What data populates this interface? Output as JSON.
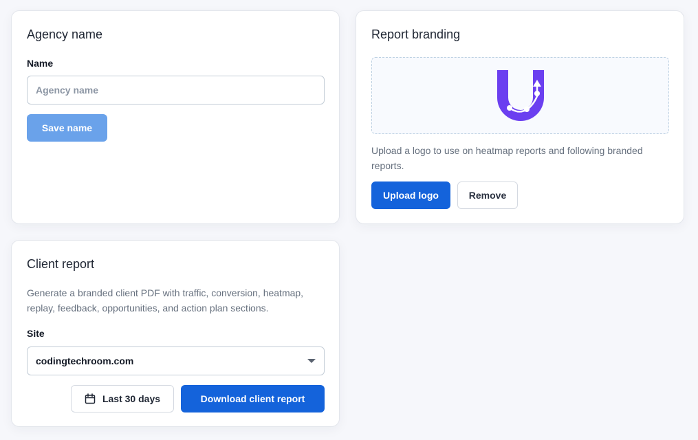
{
  "agency": {
    "title": "Agency name",
    "name_label": "Name",
    "name_placeholder": "Agency name",
    "name_value": "",
    "save_label": "Save name"
  },
  "branding": {
    "title": "Report branding",
    "logo_icon": "u-logo-icon",
    "logo_color": "#6b3ff0",
    "description": "Upload a logo to use on heatmap reports and following branded reports.",
    "upload_label": "Upload logo",
    "remove_label": "Remove"
  },
  "client_report": {
    "title": "Client report",
    "description": "Generate a branded client PDF with traffic, conversion, heatmap, replay, feedback, opportunities, and action plan sections.",
    "site_label": "Site",
    "site_value": "codingtechroom.com",
    "date_range_icon": "calendar-icon",
    "date_range_label": "Last 30 days",
    "download_label": "Download client report"
  },
  "colors": {
    "primary": "#1463db",
    "primary_disabled": "#6aa2ea",
    "page_background": "#f6f7fb"
  }
}
